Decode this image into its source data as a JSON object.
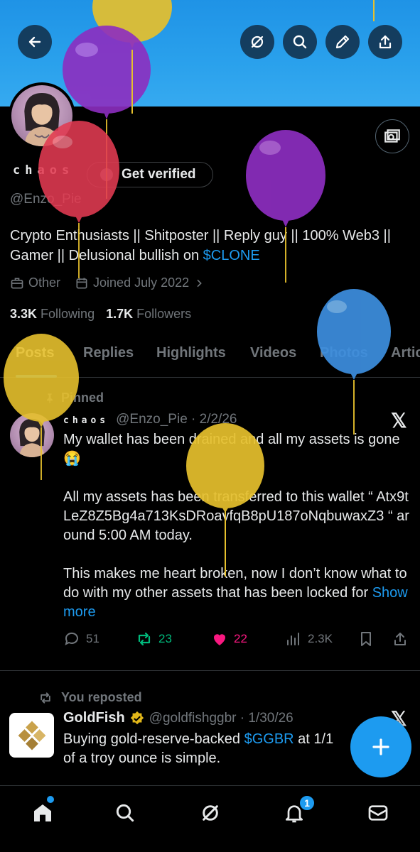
{
  "profile": {
    "display_name": "chaos",
    "handle": "@Enzo_Pie",
    "verify_label": "Get verified",
    "bio_text": "Crypto Enthusiasts || Shitposter || Reply guy || 100% Web3 || Gamer || Delusional bullish on ",
    "bio_link": "$CLONE",
    "category": "Other",
    "joined": "Joined July 2022",
    "following_count": "3.3K",
    "following_label": "Following",
    "followers_count": "1.7K",
    "followers_label": "Followers"
  },
  "tabs": [
    "Posts",
    "Replies",
    "Highlights",
    "Videos",
    "Photos",
    "Artic"
  ],
  "pinned_post": {
    "pinned_label": "Pinned",
    "author": "chaos",
    "meta": "@Enzo_Pie · 2/2/26",
    "line1": "My wallet has been drained and all my assets is gone😭",
    "line2": "All my assets has been transferred to this wallet “ Atx9tLeZ8Z5Bg4a713KsDRoavfqB8pU187oNqbuwaxZ3 “ around 5:00 AM today.",
    "line3": "This makes me  heart broken, now I don’t know what to do with my other assets that has been locked for ",
    "show_more": "Show more",
    "replies": "51",
    "reposts": "23",
    "likes": "22",
    "views": "2.3K"
  },
  "repost": {
    "label": "You reposted",
    "author": "GoldFish",
    "meta": "@goldfishggbr · 1/30/26",
    "text_before": "Buying gold-reserve-backed ",
    "text_link": "$GGBR",
    "text_after": " at 1/1 of a troy ounce is simple."
  },
  "nav": {
    "notifications_badge": "1",
    "icons": [
      "home-icon",
      "search-icon",
      "grok-icon",
      "bell-icon",
      "mail-icon"
    ]
  },
  "colors": {
    "accent": "#1d9bf0",
    "like": "#f91880",
    "repost": "#00ba7c",
    "banner": "#1f93e6"
  }
}
